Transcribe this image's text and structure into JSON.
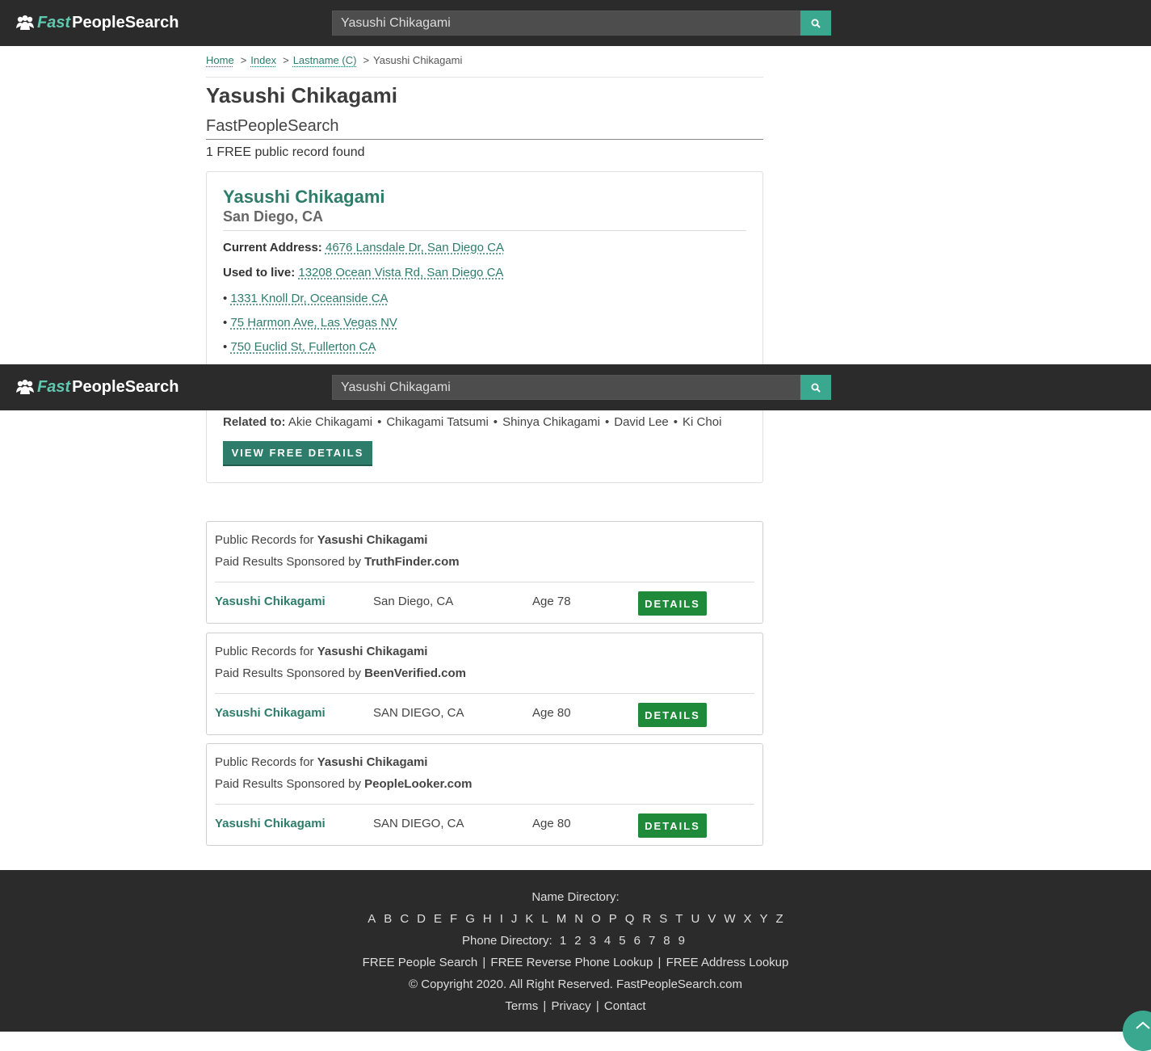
{
  "header": {
    "logo_fast": "Fast",
    "logo_people": "PeopleSearch",
    "search_value": "Yasushi Chikagami"
  },
  "breadcrumb": {
    "home": "Home",
    "index": "Index",
    "lastname": "Lastname (C)",
    "current": "Yasushi Chikagami"
  },
  "page": {
    "title": "Yasushi Chikagami",
    "subtitle": "FastPeopleSearch",
    "found": "1 FREE public record found"
  },
  "card": {
    "name": "Yasushi Chikagami",
    "location": "San Diego, CA",
    "current_label": "Current Address:",
    "current_address": "4676 Lansdale Dr, San Diego CA",
    "used_label": "Used to live:",
    "used_address": "13208 Ocean Vista Rd, San Diego CA",
    "past": [
      "1331 Knoll Dr, Oceanside CA",
      "75 Harmon Ave, Las Vegas NV",
      "750 Euclid St, Fullerton CA"
    ],
    "related_label": "Related to:",
    "related": [
      "Akie Chikagami",
      "Chikagami Tatsumi",
      "Shinya Chikagami",
      "David Lee",
      "Ki Choi"
    ],
    "button": "VIEW FREE DETAILS"
  },
  "sponsored": [
    {
      "prefix": "Public Records for",
      "name_bold": "Yasushi Chikagami",
      "paid": "Paid Results Sponsored by",
      "sponsor": "TruthFinder.com",
      "result_name": "Yasushi Chikagami",
      "city": "San Diego, CA",
      "age": "Age 78",
      "button": "DETAILS"
    },
    {
      "prefix": "Public Records for",
      "name_bold": "Yasushi Chikagami",
      "paid": "Paid Results Sponsored by",
      "sponsor": "BeenVerified.com",
      "result_name": "Yasushi Chikagami",
      "city": "SAN DIEGO, CA",
      "age": "Age 80",
      "button": "DETAILS"
    },
    {
      "prefix": "Public Records for",
      "name_bold": "Yasushi Chikagami",
      "paid": "Paid Results Sponsored by",
      "sponsor": "PeopleLooker.com",
      "result_name": "Yasushi Chikagami",
      "city": "SAN DIEGO, CA",
      "age": "Age 80",
      "button": "DETAILS"
    }
  ],
  "footer": {
    "name_directory": "Name Directory:",
    "letters": [
      "A",
      "B",
      "C",
      "D",
      "E",
      "F",
      "G",
      "H",
      "I",
      "J",
      "K",
      "L",
      "M",
      "N",
      "O",
      "P",
      "Q",
      "R",
      "S",
      "T",
      "U",
      "V",
      "W",
      "X",
      "Y",
      "Z"
    ],
    "phone_directory": "Phone Directory:",
    "digits": [
      "1",
      "2",
      "3",
      "4",
      "5",
      "6",
      "7",
      "8",
      "9"
    ],
    "links": [
      "FREE People Search",
      "FREE Reverse Phone Lookup",
      "FREE Address Lookup"
    ],
    "copyright": "© Copyright 2020. All Right Reserved. FastPeopleSearch.com",
    "bottom_links": [
      "Terms",
      "Privacy",
      "Contact"
    ]
  },
  "colors": {
    "header_bg": "#2b2b2b",
    "accent": "#2e7d6b",
    "logo_fast": "#5fc9b0",
    "search_button": "#3aa88e",
    "details_button": "#1e8a3a"
  },
  "icons": {
    "logo": "users-icon",
    "search": "search-icon",
    "scroll_top": "chevron-up-icon"
  }
}
